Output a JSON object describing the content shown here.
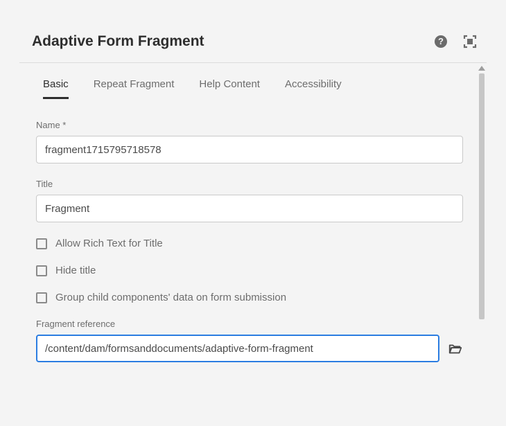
{
  "header": {
    "title": "Adaptive Form Fragment"
  },
  "tabs": [
    {
      "label": "Basic",
      "active": true
    },
    {
      "label": "Repeat Fragment",
      "active": false
    },
    {
      "label": "Help Content",
      "active": false
    },
    {
      "label": "Accessibility",
      "active": false
    }
  ],
  "fields": {
    "name": {
      "label": "Name *",
      "value": "fragment1715795718578"
    },
    "title": {
      "label": "Title",
      "value": "Fragment"
    },
    "allowRichText": {
      "label": "Allow Rich Text for Title"
    },
    "hideTitle": {
      "label": "Hide title"
    },
    "groupChildData": {
      "label": "Group child components' data on form submission"
    },
    "fragmentReference": {
      "label": "Fragment reference",
      "value": "/content/dam/formsanddocuments/adaptive-form-fragment"
    }
  }
}
